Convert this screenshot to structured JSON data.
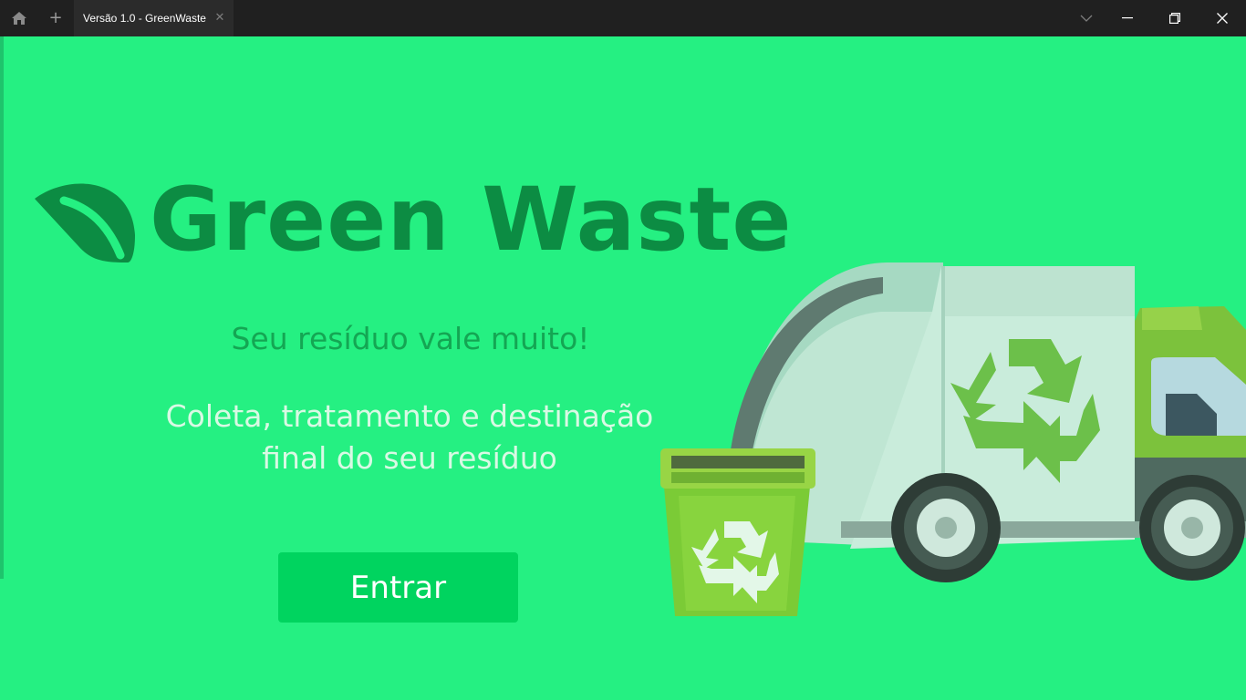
{
  "window": {
    "tab_title": "Versão 1.0 - GreenWaste",
    "tab_close_icon": "close-icon",
    "new_tab_label": "+",
    "home_icon": "home-icon"
  },
  "brand": {
    "logo_icon": "leaf-icon",
    "name": "Green Waste",
    "color": "#0c8c43"
  },
  "hero": {
    "tagline": "Seu resíduo vale muito!",
    "description": "Coleta, tratamento e destinação final do seu resíduo"
  },
  "actions": {
    "enter_label": "Entrar"
  },
  "illustration": {
    "truck": "garbage-truck-icon",
    "bin": "recycle-bin-icon",
    "symbol": "recycle-icon"
  },
  "colors": {
    "background": "#25f082",
    "button": "#00d45f",
    "titlebar": "#202020"
  }
}
